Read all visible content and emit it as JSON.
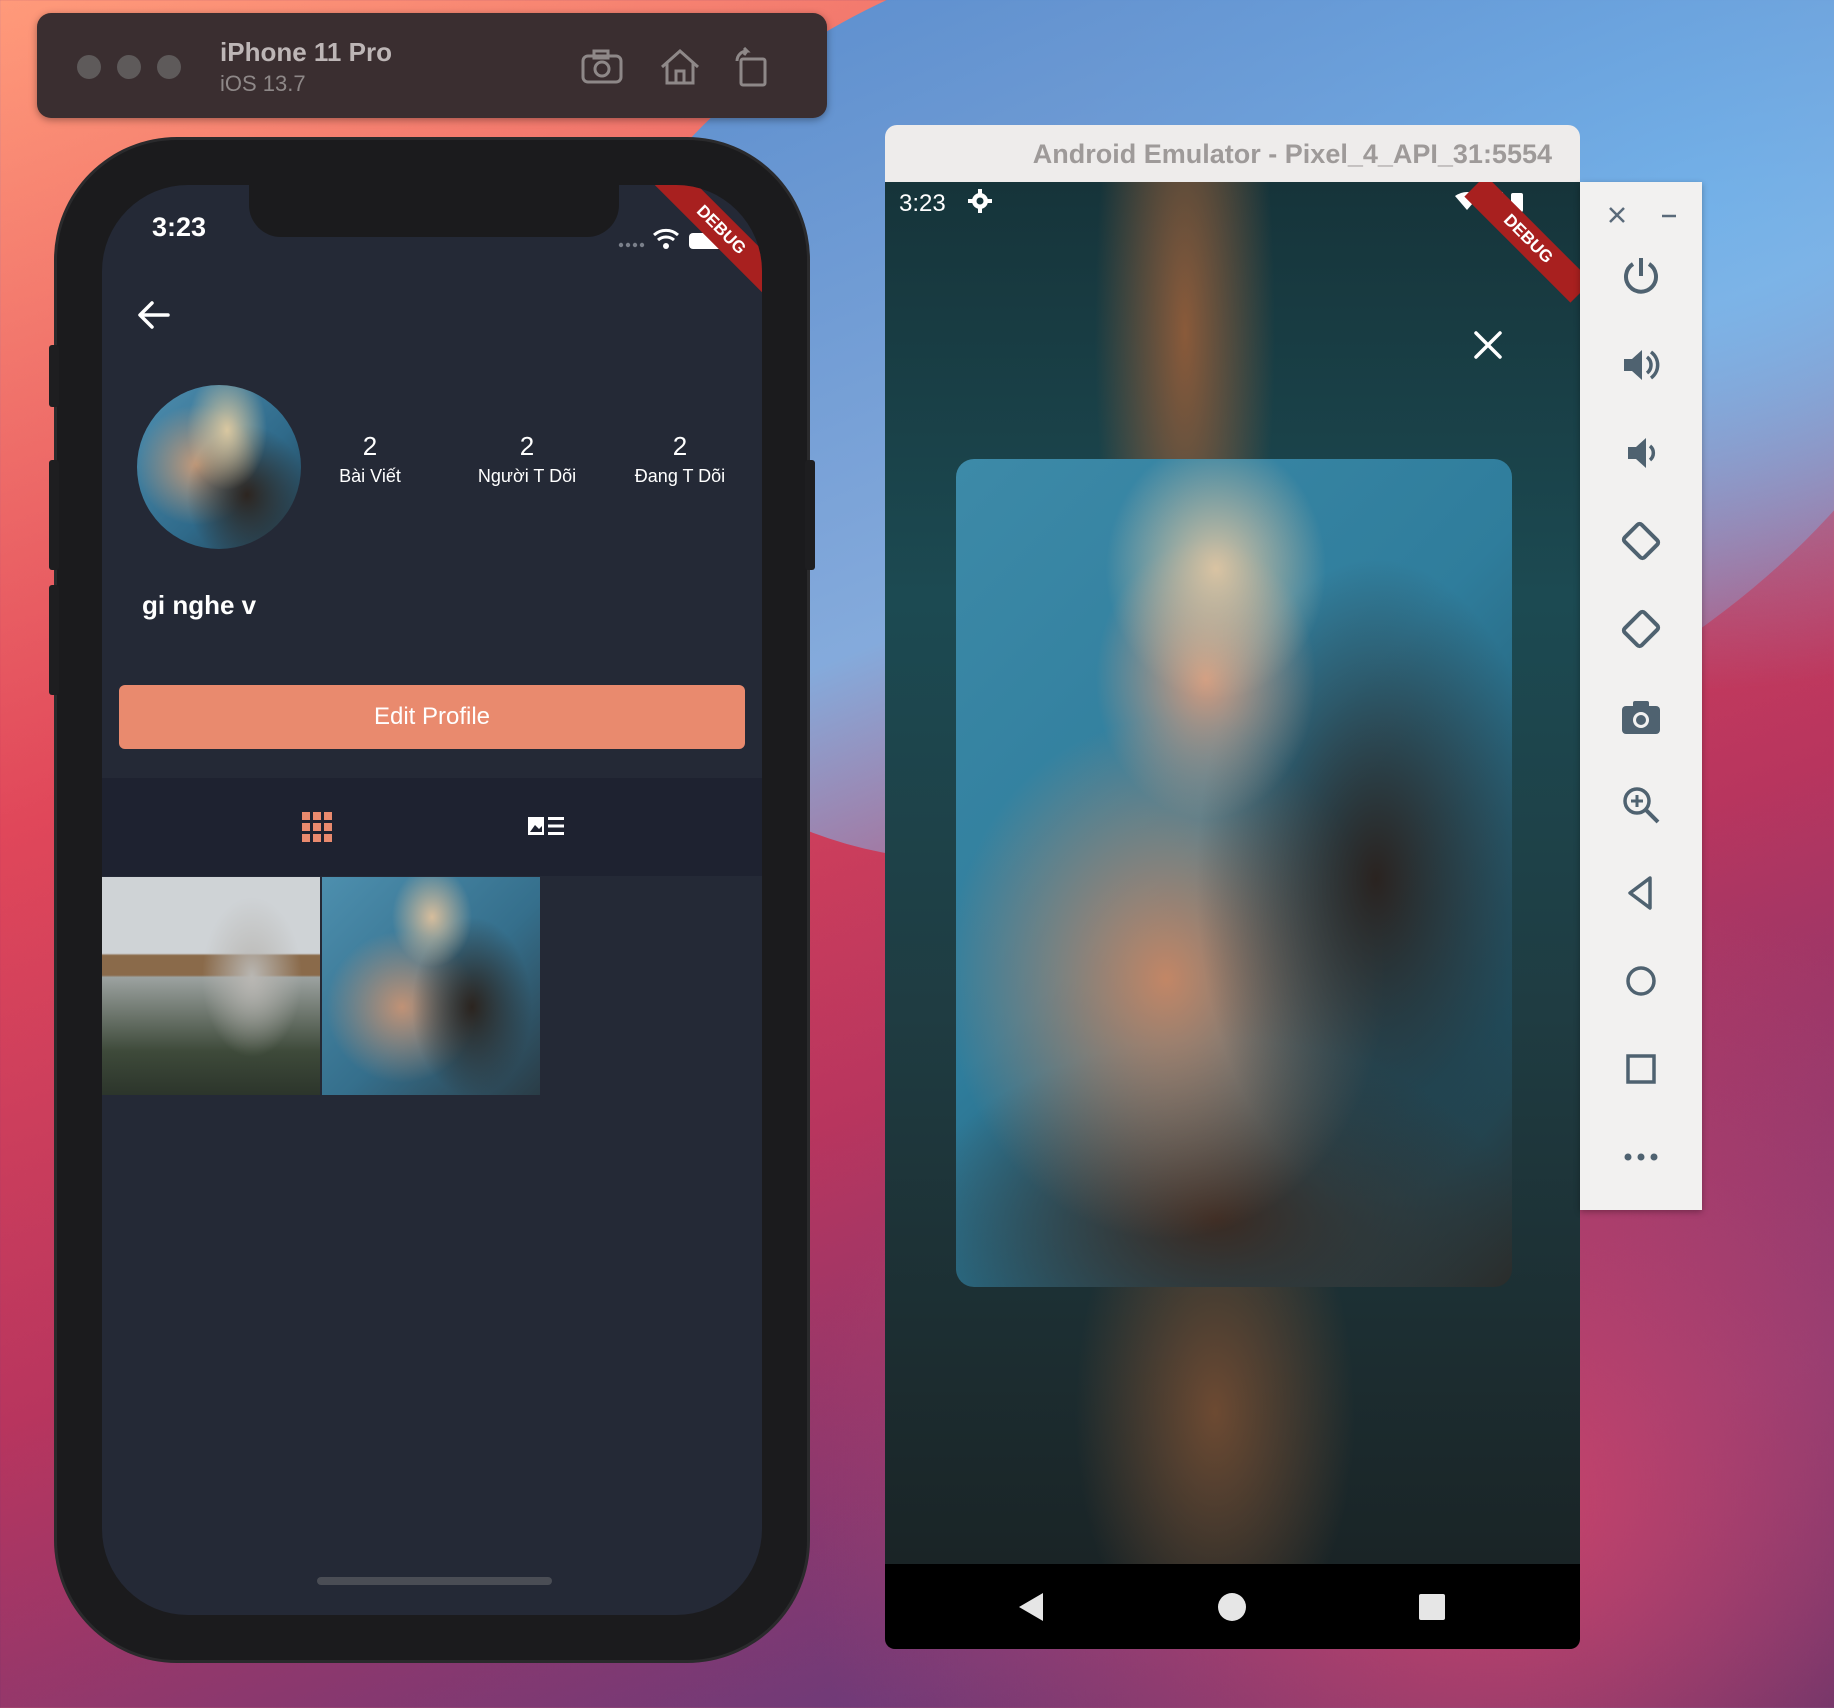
{
  "ios_simulator": {
    "device_name": "iPhone 11 Pro",
    "os_version": "iOS 13.7",
    "toolbar_icons": [
      "screenshot-icon",
      "home-icon",
      "rotate-icon"
    ]
  },
  "ios_app": {
    "status_time": "3:23",
    "debug_label": "DEBUG",
    "stats": [
      {
        "value": "2",
        "label": "Bài Viết"
      },
      {
        "value": "2",
        "label": "Người T Dõi"
      },
      {
        "value": "2",
        "label": "Đang T Dõi"
      }
    ],
    "username": "gi nghe v",
    "edit_button_label": "Edit Profile",
    "tabs": [
      "grid-icon",
      "list-icon"
    ],
    "accent_color": "#e98a6e"
  },
  "android_emulator": {
    "window_title": "Android Emulator - Pixel_4_API_31:5554",
    "status_time": "3:23",
    "debug_label": "DEBUG",
    "side_controls": [
      "power",
      "volume-up",
      "volume-down",
      "rotate-left",
      "rotate-right",
      "camera",
      "zoom",
      "back",
      "home",
      "overview",
      "more"
    ]
  }
}
